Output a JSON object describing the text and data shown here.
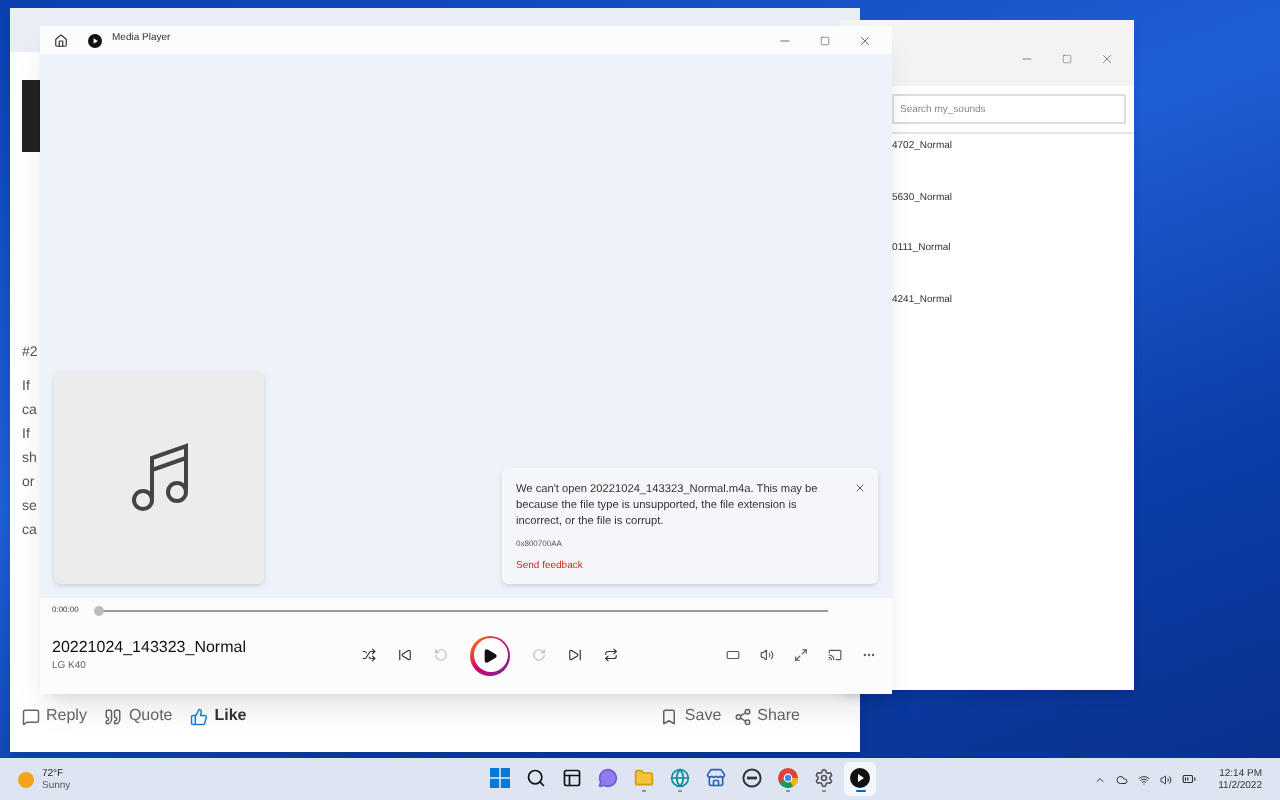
{
  "browser": {
    "post_number": "#2",
    "fragments": [
      "If",
      "ca",
      "If",
      "sh",
      "or",
      "se",
      "ca"
    ],
    "actions_left": [
      {
        "kind": "reply",
        "label": "Reply"
      },
      {
        "kind": "quote",
        "label": "Quote"
      },
      {
        "kind": "like",
        "label": "Like"
      }
    ],
    "actions_right": [
      {
        "kind": "save",
        "label": "Save"
      },
      {
        "kind": "share",
        "label": "Share"
      }
    ]
  },
  "explorer": {
    "search": {
      "placeholder": "Search my_sounds"
    },
    "files": [
      "4702_Normal",
      "5630_Normal",
      "0111_Normal",
      "4241_Normal"
    ]
  },
  "media_player": {
    "title": "Media Player",
    "error": {
      "message": "We can't open 20221024_143323_Normal.m4a. This may be because the file type is unsupported, the file extension is incorrect, or the file is corrupt.",
      "code": "0x800700AA",
      "link": "Send feedback"
    },
    "position": "0:00:00",
    "seek": {
      "level": 0
    },
    "track": {
      "title": "20221024_143323_Normal",
      "artist": "LG K40"
    },
    "controls": [
      {
        "kind": "shuffle",
        "disabled": false
      },
      {
        "kind": "previous",
        "disabled": false
      },
      {
        "kind": "back",
        "disabled": true
      },
      {
        "kind": "play",
        "disabled": false
      },
      {
        "kind": "forward",
        "disabled": true
      },
      {
        "kind": "next",
        "disabled": false
      },
      {
        "kind": "repeat",
        "disabled": false
      }
    ],
    "tools": [
      {
        "kind": "miniplayer"
      },
      {
        "kind": "volume"
      },
      {
        "kind": "fullscreen"
      },
      {
        "kind": "cast"
      },
      {
        "kind": "more"
      }
    ]
  },
  "taskbar": {
    "weather": {
      "temp": "72°F",
      "condition": "Sunny"
    },
    "apps": [
      {
        "kind": "start",
        "running": false,
        "selected": false
      },
      {
        "kind": "search",
        "running": false,
        "selected": false
      },
      {
        "kind": "taskview",
        "running": false,
        "selected": false
      },
      {
        "kind": "chat",
        "running": false,
        "selected": false
      },
      {
        "kind": "folder",
        "running": true,
        "selected": false
      },
      {
        "kind": "edge",
        "running": true,
        "selected": false
      },
      {
        "kind": "store",
        "running": false,
        "selected": false
      },
      {
        "kind": "dell",
        "running": false,
        "selected": false
      },
      {
        "kind": "chrome",
        "running": true,
        "selected": false
      },
      {
        "kind": "settings",
        "running": true,
        "selected": false
      },
      {
        "kind": "player",
        "running": true,
        "selected": true
      }
    ],
    "time": "12:14 PM",
    "date": "11/2/2022"
  }
}
